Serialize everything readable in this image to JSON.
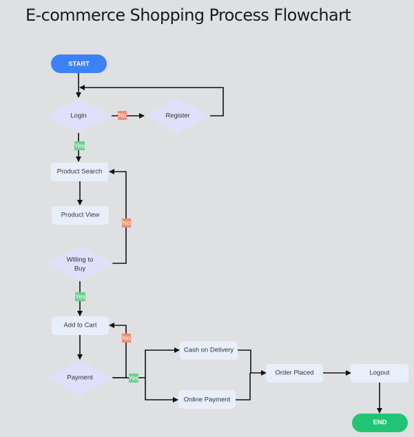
{
  "title": "E-commerce Shopping Process Flowchart",
  "colors": {
    "background": "#dfe0e2",
    "start": "#3b82f6",
    "end": "#22c574",
    "process": "#e8effb",
    "decision": "#e0e0fa",
    "label_no": "#f08c76",
    "label_yes": "#6bd08e",
    "edge": "#111111"
  },
  "nodes": {
    "start": "START",
    "login": "Login",
    "register": "Register",
    "product_search": "Product Search",
    "product_view": "Product View",
    "willing_to_buy_1": "Willing to",
    "willing_to_buy_2": "Buy",
    "add_to_cart": "Add to Cart",
    "payment": "Payment",
    "cash_on_delivery": "Cash on Delivery",
    "online_payment": "Online Payment",
    "order_placed": "Order Placed",
    "logout": "Logout",
    "end": "END"
  },
  "edge_labels": {
    "login_no": "No",
    "login_yes": "Yes",
    "willing_no": "No",
    "willing_yes": "Yes",
    "payment_no": "No",
    "payment_yes": "Yes"
  }
}
